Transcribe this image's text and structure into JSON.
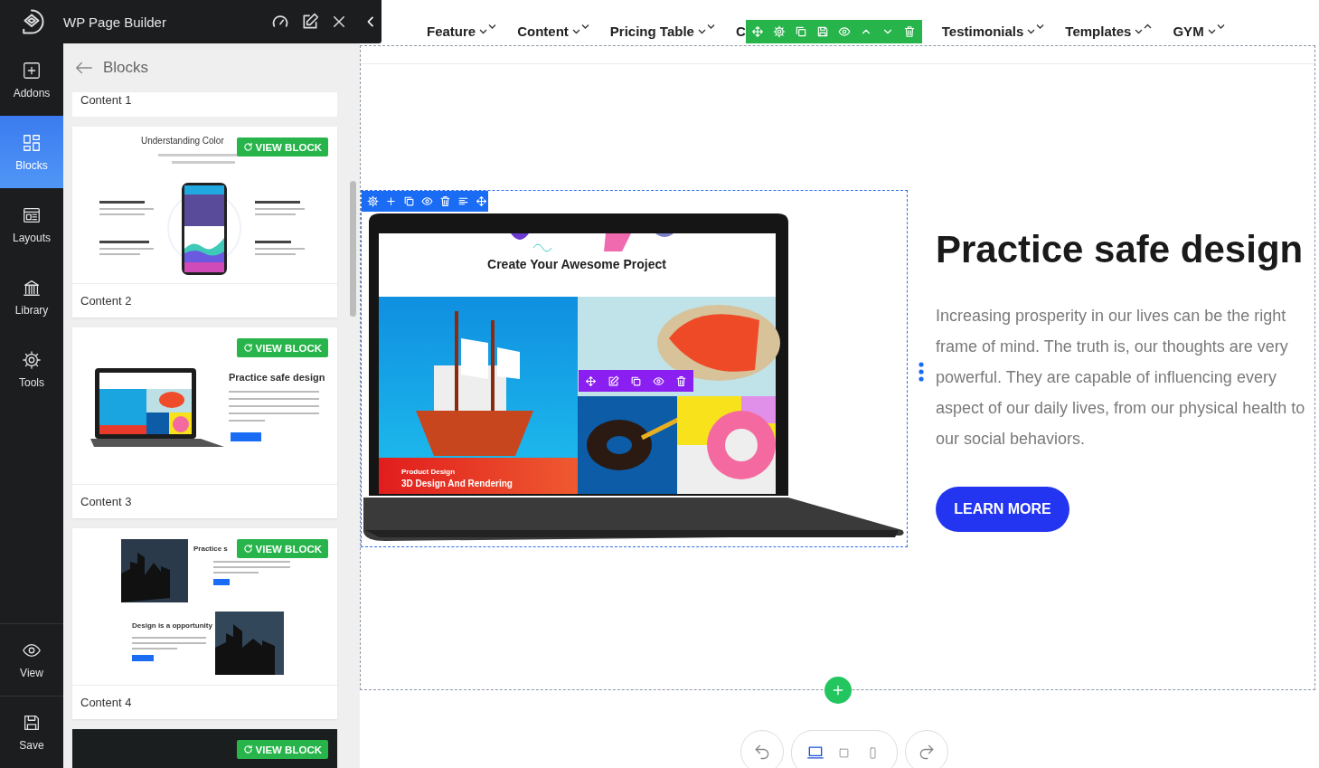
{
  "panel": {
    "title": "WP Page Builder",
    "back_label": "Blocks"
  },
  "rail": {
    "items": [
      {
        "label": "Addons",
        "selected": false
      },
      {
        "label": "Blocks",
        "selected": true
      },
      {
        "label": "Layouts",
        "selected": false
      },
      {
        "label": "Library",
        "selected": false
      },
      {
        "label": "Tools",
        "selected": false
      }
    ],
    "bottom_items": [
      {
        "label": "View",
        "selected": false
      },
      {
        "label": "Save",
        "selected": false
      }
    ]
  },
  "blocks": [
    {
      "kind": "cut",
      "label": "Content 1"
    },
    {
      "kind": "app",
      "label": "Content 2",
      "heading": "Understanding Color",
      "button": "VIEW BLOCK"
    },
    {
      "kind": "laptop",
      "label": "Content 3",
      "heading": "Practice safe design",
      "button": "VIEW BLOCK"
    },
    {
      "kind": "photos",
      "label": "Content 4",
      "heading": "Practice s",
      "heading_2": "Design is a opportunity",
      "button": "VIEW BLOCK"
    },
    {
      "kind": "dark",
      "button": "VIEW BLOCK"
    }
  ],
  "nav": [
    {
      "kind": "link",
      "label": "Feature",
      "expanded": false
    },
    {
      "kind": "link",
      "label": "Content",
      "expanded": false
    },
    {
      "kind": "link",
      "label": "Pricing Table",
      "expanded": false
    },
    {
      "kind": "covered",
      "label": "C"
    },
    {
      "kind": "link",
      "label": "Testimonials",
      "expanded": false
    },
    {
      "kind": "link",
      "label": "Templates",
      "expanded": true
    },
    {
      "kind": "link",
      "label": "GYM",
      "expanded": false
    }
  ],
  "hero": {
    "screen_title": "Create Your Awesome Project",
    "screen_caption": "Product Design",
    "screen_subtitle": "3D Design And Rendering",
    "heading": "Practice safe design",
    "text": "Increasing prosperity in our lives can be the right frame of mind. The truth is, our thoughts are very powerful. They are capable of influencing every aspect of our daily lives, from our physical health to our social behaviors.",
    "button": "LEARN MORE"
  },
  "device_bar": {
    "devices": [
      {
        "selected": true
      },
      {
        "selected": false
      },
      {
        "selected": false
      }
    ]
  }
}
